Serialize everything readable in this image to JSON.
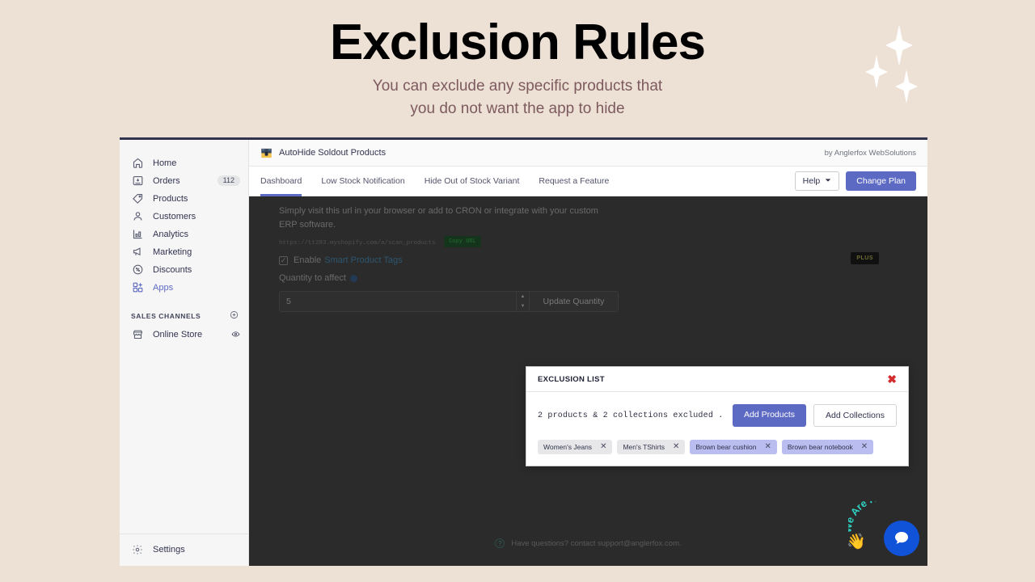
{
  "hero": {
    "title": "Exclusion Rules",
    "subtitle_line1": "You can exclude any specific products that",
    "subtitle_line2": "you do not want the app to hide",
    "title_color": "#000000",
    "subtitle_color": "#7d5a5f",
    "background_color": "#ede0d4"
  },
  "decor": {
    "sparkle_color": "#ffffff",
    "sparkle_count": 3
  },
  "sidebar": {
    "items": [
      {
        "label": "Home",
        "icon": "home-icon",
        "badge": ""
      },
      {
        "label": "Orders",
        "icon": "orders-icon",
        "badge": "112"
      },
      {
        "label": "Products",
        "icon": "products-tag-icon",
        "badge": ""
      },
      {
        "label": "Customers",
        "icon": "customers-icon",
        "badge": ""
      },
      {
        "label": "Analytics",
        "icon": "analytics-bar-icon",
        "badge": ""
      },
      {
        "label": "Marketing",
        "icon": "marketing-megaphone-icon",
        "badge": ""
      },
      {
        "label": "Discounts",
        "icon": "discounts-icon",
        "badge": ""
      },
      {
        "label": "Apps",
        "icon": "apps-grid-icon",
        "badge": ""
      }
    ],
    "section_title": "SALES CHANNELS",
    "channels": [
      {
        "label": "Online Store",
        "icon": "storefront-icon"
      }
    ],
    "footer": {
      "label": "Settings",
      "icon": "gear-icon"
    },
    "active_item": "Apps",
    "active_color": "#5c6ac4"
  },
  "app": {
    "name": "AutoHide Soldout Products",
    "vendor": "by Anglerfox WebSolutions",
    "icon": "app-logo-icon",
    "tabs": [
      {
        "label": "Dashboard",
        "selected": true
      },
      {
        "label": "Low Stock Notification",
        "selected": false
      },
      {
        "label": "Hide Out of Stock Variant",
        "selected": false
      },
      {
        "label": "Request a Feature",
        "selected": false
      }
    ],
    "help_button": "Help",
    "change_plan_button": "Change Plan",
    "accent_color": "#5c6ac4"
  },
  "background_content": {
    "paragraph": "Simply visit this url in your browser or add to CRON or integrate with your custom ERP software.",
    "url": "https://tt283.myshopify.com/a/scan_products",
    "copy_url_button": "Copy URL",
    "enable_label": "Enable",
    "enable_link": "Smart Product Tags",
    "plus_badge": "PLUS",
    "quantity_label": "Quantity to affect",
    "quantity_value": "5",
    "update_quantity_button": "Update Quantity",
    "footer_text": "Have questions? contact support@anglerfox.com."
  },
  "chat": {
    "label": "We Are Here!",
    "bubble_color": "#1052d8",
    "label_color": "#2dd4c4",
    "hand_icon": "waving-hand-icon",
    "bubble_icon": "chat-bubble-icon"
  },
  "modal": {
    "title": "EXCLUSION LIST",
    "close_icon": "close-icon",
    "close_color": "#d42c2c",
    "summary": "2 products & 2 collections excluded .",
    "add_products_button": "Add Products",
    "add_collections_button": "Add Collections",
    "chips": [
      {
        "label": "Women's Jeans",
        "kind": "product"
      },
      {
        "label": "Men's TShirts",
        "kind": "product"
      },
      {
        "label": "Brown bear cushion",
        "kind": "collection"
      },
      {
        "label": "Brown bear notebook",
        "kind": "collection"
      }
    ],
    "chip_product_color": "#e7e7ea",
    "chip_collection_color": "#b9bdf0"
  }
}
